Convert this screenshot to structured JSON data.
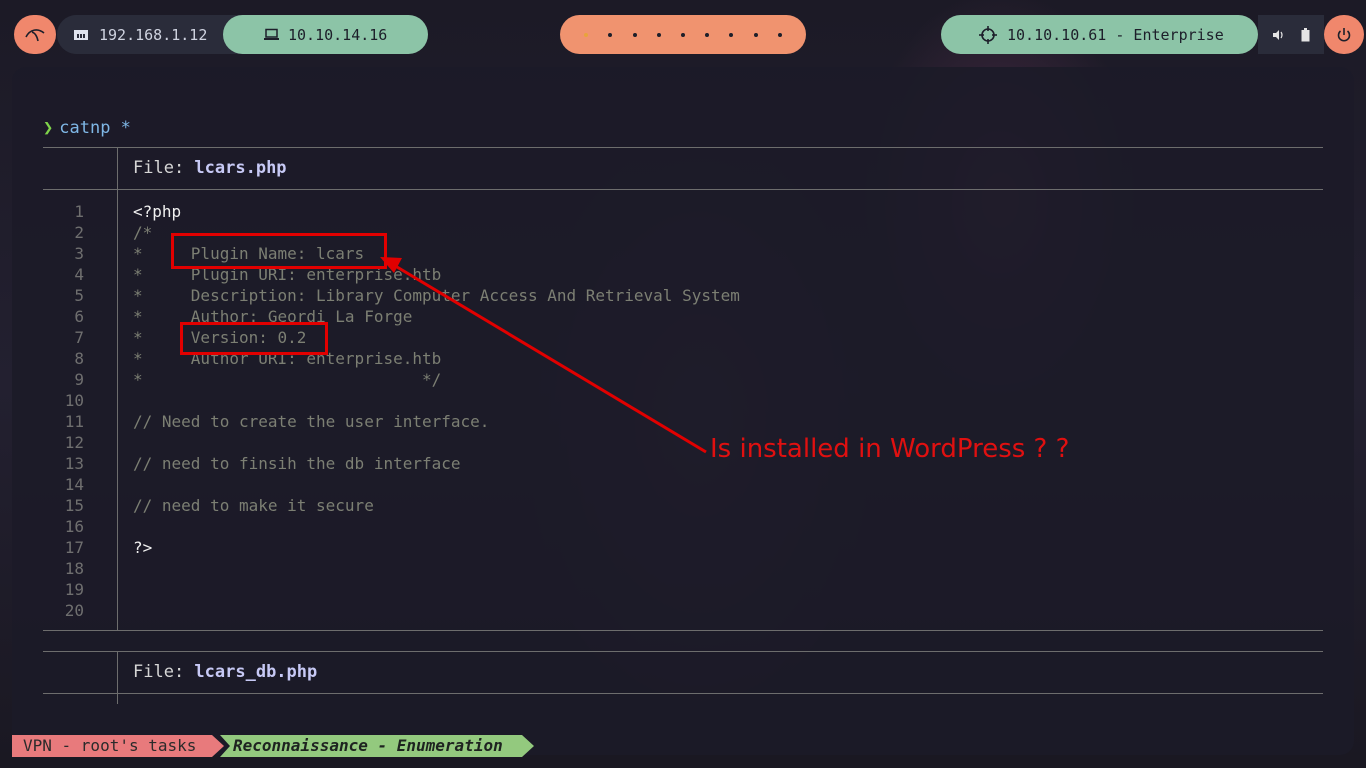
{
  "topbar": {
    "local_ip": "192.168.1.12",
    "vpn_ip": "10.10.14.16",
    "workspaces": [
      "",
      "",
      "",
      "",
      "",
      "",
      "",
      "",
      ""
    ],
    "target": "10.10.10.61 - Enterprise",
    "icons": [
      "kali-icon",
      "ethernet-icon",
      "laptop-icon",
      "crosshair-icon",
      "volume-icon",
      "battery-icon",
      "power-icon"
    ]
  },
  "terminal": {
    "prompt_symbol": "❯",
    "command": "catnp *",
    "file1": {
      "label": "File: ",
      "name": "lcars.php"
    },
    "file2": {
      "label": "File: ",
      "name": "lcars_db.php"
    },
    "lines": [
      {
        "n": "1",
        "text": "<?php"
      },
      {
        "n": "2",
        "text": "/*"
      },
      {
        "n": "3",
        "text": "*     Plugin Name: lcars"
      },
      {
        "n": "4",
        "text": "*     Plugin URI: enterprise.htb"
      },
      {
        "n": "5",
        "text": "*     Description: Library Computer Access And Retrieval System"
      },
      {
        "n": "6",
        "text": "*     Author: Geordi La Forge"
      },
      {
        "n": "7",
        "text": "*     Version: 0.2"
      },
      {
        "n": "8",
        "text": "*     Author URI: enterprise.htb"
      },
      {
        "n": "9",
        "text": "*                             */"
      },
      {
        "n": "10",
        "text": ""
      },
      {
        "n": "11",
        "text": "// Need to create the user interface."
      },
      {
        "n": "12",
        "text": ""
      },
      {
        "n": "13",
        "text": "// need to finsih the db interface"
      },
      {
        "n": "14",
        "text": ""
      },
      {
        "n": "15",
        "text": "// need to make it secure"
      },
      {
        "n": "16",
        "text": ""
      },
      {
        "n": "17",
        "text": "?>"
      },
      {
        "n": "18",
        "text": ""
      },
      {
        "n": "19",
        "text": ""
      },
      {
        "n": "20",
        "text": ""
      }
    ],
    "annotation": "Is installed in WordPress ? ?",
    "annotation_color": "#e01010"
  },
  "statusbar": {
    "session": "VPN - root's tasks",
    "phase": "Reconnaissance - Enumeration"
  }
}
